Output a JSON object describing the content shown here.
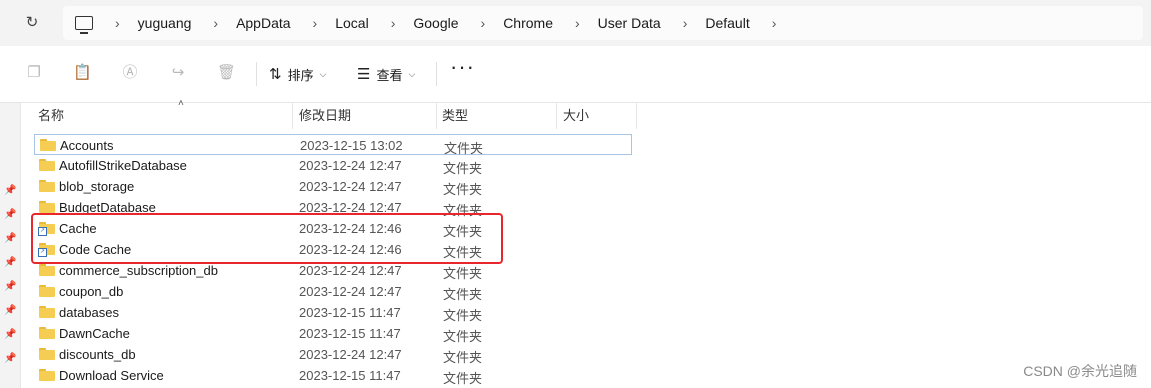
{
  "breadcrumb": [
    "yuguang",
    "AppData",
    "Local",
    "Google",
    "Chrome",
    "User Data",
    "Default"
  ],
  "toolbar": {
    "sort_label": "排序",
    "view_label": "查看",
    "more_label": "···"
  },
  "columns": {
    "name": "名称",
    "modified": "修改日期",
    "type": "类型",
    "size": "大小"
  },
  "rows": [
    {
      "name": "Accounts",
      "date": "2023-12-15 13:02",
      "type": "文件夹",
      "shortcut": false,
      "selected": true
    },
    {
      "name": "AutofillStrikeDatabase",
      "date": "2023-12-24 12:47",
      "type": "文件夹",
      "shortcut": false
    },
    {
      "name": "blob_storage",
      "date": "2023-12-24 12:47",
      "type": "文件夹",
      "shortcut": false
    },
    {
      "name": "BudgetDatabase",
      "date": "2023-12-24 12:47",
      "type": "文件夹",
      "shortcut": false
    },
    {
      "name": "Cache",
      "date": "2023-12-24 12:46",
      "type": "文件夹",
      "shortcut": true
    },
    {
      "name": "Code Cache",
      "date": "2023-12-24 12:46",
      "type": "文件夹",
      "shortcut": true
    },
    {
      "name": "commerce_subscription_db",
      "date": "2023-12-24 12:47",
      "type": "文件夹",
      "shortcut": false
    },
    {
      "name": "coupon_db",
      "date": "2023-12-24 12:47",
      "type": "文件夹",
      "shortcut": false
    },
    {
      "name": "databases",
      "date": "2023-12-15 11:47",
      "type": "文件夹",
      "shortcut": false
    },
    {
      "name": "DawnCache",
      "date": "2023-12-15 11:47",
      "type": "文件夹",
      "shortcut": false
    },
    {
      "name": "discounts_db",
      "date": "2023-12-24 12:47",
      "type": "文件夹",
      "shortcut": false
    },
    {
      "name": "Download Service",
      "date": "2023-12-15 11:47",
      "type": "文件夹",
      "shortcut": false
    }
  ],
  "watermark": "CSDN @余光追随",
  "colors": {
    "highlight": "#e8262b",
    "folder": "#f5cd52",
    "selection": "#a9c4e6"
  }
}
